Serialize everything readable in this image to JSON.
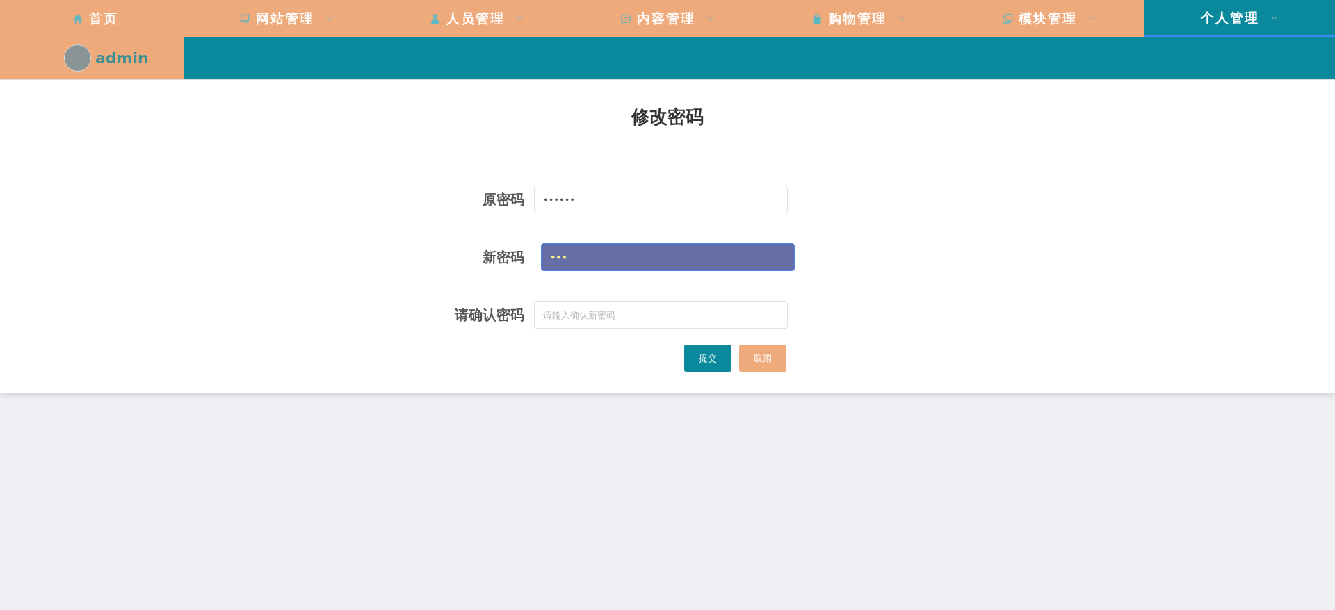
{
  "nav": [
    {
      "label": "首页",
      "kind": "home",
      "dropdown": false,
      "selected": false
    },
    {
      "label": "网站管理",
      "kind": "monitor",
      "dropdown": true,
      "selected": false
    },
    {
      "label": "人员管理",
      "kind": "user",
      "dropdown": true,
      "selected": false
    },
    {
      "label": "内容管理",
      "kind": "chat",
      "dropdown": true,
      "selected": false
    },
    {
      "label": "购物管理",
      "kind": "bag",
      "dropdown": true,
      "selected": false
    },
    {
      "label": "模块管理",
      "kind": "copy",
      "dropdown": true,
      "selected": false
    },
    {
      "label": "个人管理",
      "kind": "plain",
      "dropdown": true,
      "selected": true
    }
  ],
  "user": {
    "name": "admin"
  },
  "form": {
    "title": "修改密码",
    "fields": [
      {
        "label": "原密码",
        "value": "••••••",
        "focused": false
      },
      {
        "label": "新密码",
        "value": "•••",
        "focused": true
      },
      {
        "label": "请确认密码",
        "placeholder": "请输入确认新密码",
        "focused": false
      }
    ],
    "buttons": [
      {
        "label": "提交",
        "kind": "primary"
      },
      {
        "label": "取消",
        "kind": "cancel"
      }
    ]
  }
}
